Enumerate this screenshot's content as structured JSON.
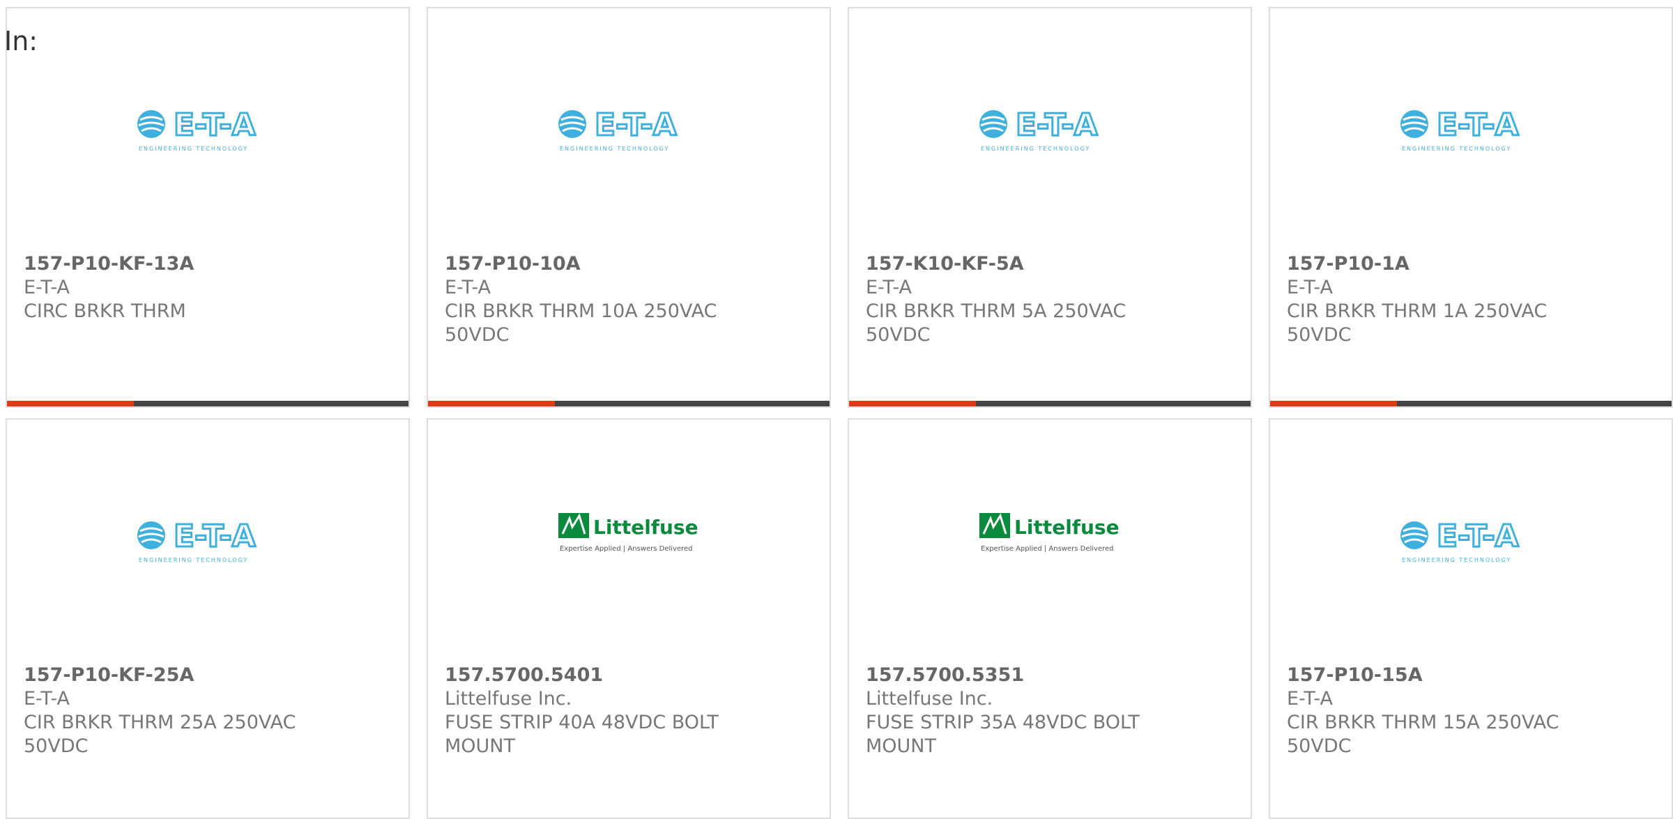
{
  "header": {
    "in_label": "In:"
  },
  "products": [
    {
      "part_number": "157-P10-KF-13A",
      "manufacturer": "E-T-A",
      "description": "CIRC BRKR THRM",
      "logo": "eta-logo",
      "logo_text": "E-T-A",
      "logo_tagline": "ENGINEERING TECHNOLOGY"
    },
    {
      "part_number": "157-P10-10A",
      "manufacturer": "E-T-A",
      "description": "CIR BRKR THRM 10A 250VAC 50VDC",
      "logo": "eta-logo",
      "logo_text": "E-T-A",
      "logo_tagline": "ENGINEERING TECHNOLOGY"
    },
    {
      "part_number": "157-K10-KF-5A",
      "manufacturer": "E-T-A",
      "description": "CIR BRKR THRM 5A 250VAC 50VDC",
      "logo": "eta-logo",
      "logo_text": "E-T-A",
      "logo_tagline": "ENGINEERING TECHNOLOGY"
    },
    {
      "part_number": "157-P10-1A",
      "manufacturer": "E-T-A",
      "description": "CIR BRKR THRM 1A 250VAC 50VDC",
      "logo": "eta-logo",
      "logo_text": "E-T-A",
      "logo_tagline": "ENGINEERING TECHNOLOGY"
    },
    {
      "part_number": "157-P10-KF-25A",
      "manufacturer": "E-T-A",
      "description": "CIR BRKR THRM 25A 250VAC 50VDC",
      "logo": "eta-logo",
      "logo_text": "E-T-A",
      "logo_tagline": "ENGINEERING TECHNOLOGY"
    },
    {
      "part_number": "157.5700.5401",
      "manufacturer": "Littelfuse Inc.",
      "description": "FUSE STRIP 40A 48VDC BOLT MOUNT",
      "logo": "littelfuse-logo",
      "logo_text": "Littelfuse",
      "logo_tagline": "Expertise Applied | Answers Delivered"
    },
    {
      "part_number": "157.5700.5351",
      "manufacturer": "Littelfuse Inc.",
      "description": "FUSE STRIP 35A 48VDC BOLT MOUNT",
      "logo": "littelfuse-logo",
      "logo_text": "Littelfuse",
      "logo_tagline": "Expertise Applied | Answers Delivered"
    },
    {
      "part_number": "157-P10-15A",
      "manufacturer": "E-T-A",
      "description": "CIR BRKR THRM 15A 250VAC 50VDC",
      "logo": "eta-logo",
      "logo_text": "E-T-A",
      "logo_tagline": "ENGINEERING TECHNOLOGY"
    }
  ],
  "colors": {
    "accent": "#e03b14",
    "bar": "#444444",
    "eta_blue": "#3fb0dd",
    "littelfuse_green": "#0a8a3c"
  }
}
